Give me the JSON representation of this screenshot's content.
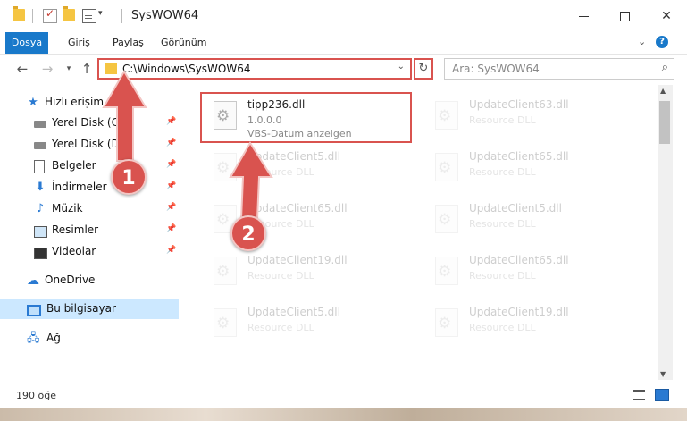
{
  "window": {
    "title": "SysWOW64"
  },
  "ribbon": {
    "tabs": [
      "Dosya",
      "Giriş",
      "Paylaş",
      "Görünüm"
    ]
  },
  "address": {
    "path": "C:\\Windows\\SysWOW64"
  },
  "search": {
    "placeholder": "Ara: SysWOW64"
  },
  "sidebar": {
    "items": [
      {
        "label": "Hızlı erişim",
        "icon": "star-icon"
      },
      {
        "label": "Yerel Disk (C:)",
        "icon": "disk-icon",
        "pinned": true
      },
      {
        "label": "Yerel Disk (D:)",
        "icon": "disk-icon",
        "pinned": true
      },
      {
        "label": "Belgeler",
        "icon": "documents-icon",
        "pinned": true
      },
      {
        "label": "İndirmeler",
        "icon": "download-icon",
        "pinned": true
      },
      {
        "label": "Müzik",
        "icon": "music-icon",
        "pinned": true
      },
      {
        "label": "Resimler",
        "icon": "pictures-icon",
        "pinned": true
      },
      {
        "label": "Videolar",
        "icon": "videos-icon",
        "pinned": true
      },
      {
        "label": "OneDrive",
        "icon": "cloud-icon"
      },
      {
        "label": "Bu bilgisayar",
        "icon": "computer-icon",
        "selected": true
      },
      {
        "label": "Ağ",
        "icon": "network-icon"
      }
    ]
  },
  "files": {
    "highlighted": {
      "name": "tipp236.dll",
      "version": "1.0.0.0",
      "description": "VBS-Datum anzeigen"
    },
    "grid": [
      {
        "name": "UpdateClient63.dll",
        "type": "Resource DLL"
      },
      {
        "name": "UpdateClient5.dll",
        "type": "Resource DLL"
      },
      {
        "name": "UpdateClient65.dll",
        "type": "Resource DLL"
      },
      {
        "name": "UpdateClient65.dll",
        "type": "Resource DLL"
      },
      {
        "name": "UpdateClient5.dll",
        "type": "Resource DLL"
      },
      {
        "name": "UpdateClient19.dll",
        "type": "Resource DLL"
      },
      {
        "name": "UpdateClient65.dll",
        "type": "Resource DLL"
      },
      {
        "name": "UpdateClient5.dll",
        "type": "Resource DLL"
      },
      {
        "name": "UpdateClient19.dll",
        "type": "Resource DLL"
      }
    ]
  },
  "status": {
    "count": "190 öğe"
  },
  "annotations": {
    "step1": "1",
    "step2": "2"
  },
  "colors": {
    "accent": "#1979ca",
    "highlight": "#d9534f",
    "selected": "#cce8ff"
  }
}
